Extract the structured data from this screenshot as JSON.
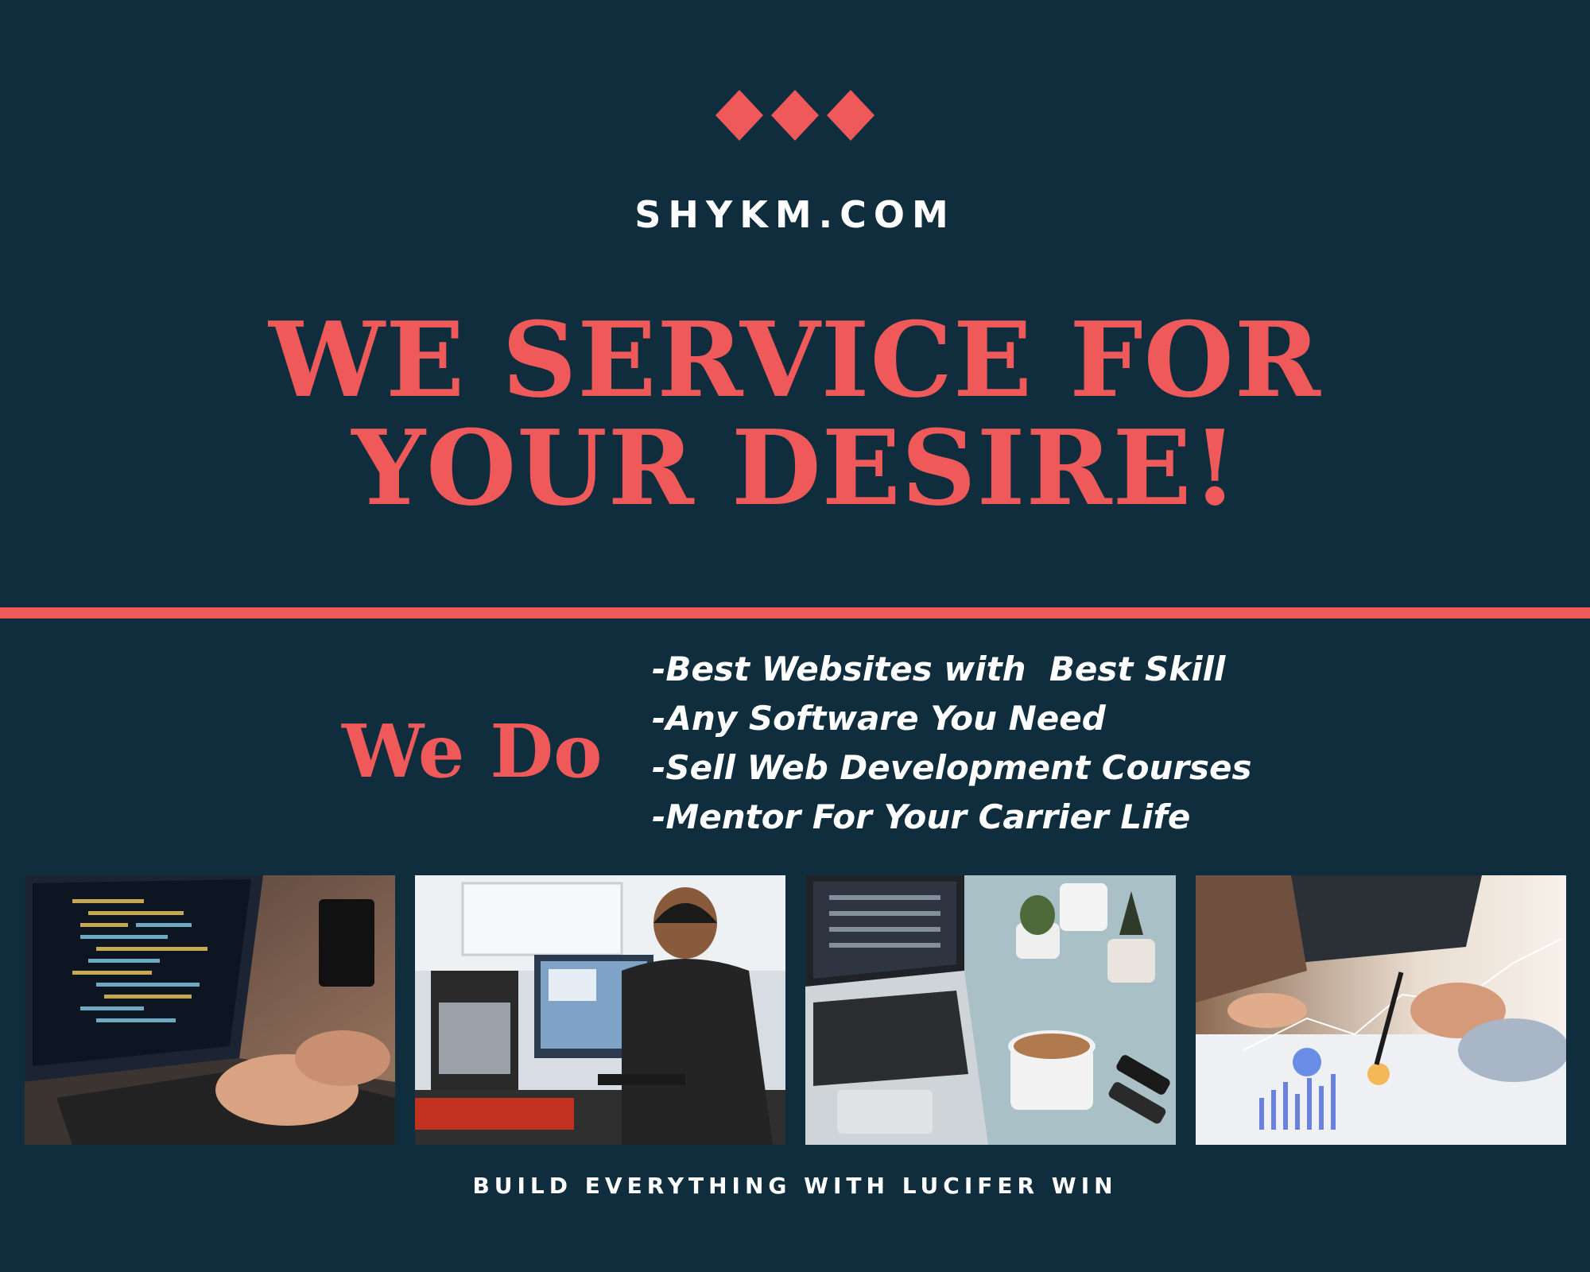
{
  "colors": {
    "background": "#0f2d3d",
    "accent": "#f0595a",
    "text": "#ffffff"
  },
  "header": {
    "diamond_icons": [
      "diamond-icon",
      "diamond-icon",
      "diamond-icon"
    ],
    "site_name": "SHYKM.COM",
    "headline_line1": "WE SERVICE FOR",
    "headline_line2": "YOUR DESIRE!"
  },
  "services": {
    "heading": "We Do",
    "items": [
      "-Best Websites with  Best Skill",
      "-Any Software You Need",
      "-Sell Web Development Courses",
      "-Mentor For Your Carrier Life"
    ]
  },
  "photos": [
    {
      "name": "photo-laptop-coding"
    },
    {
      "name": "photo-engineer-workstation"
    },
    {
      "name": "photo-desk-laptop-coffee"
    },
    {
      "name": "photo-business-charts"
    }
  ],
  "footer": {
    "tagline": "BUILD EVERYTHING WITH LUCIFER WIN"
  }
}
